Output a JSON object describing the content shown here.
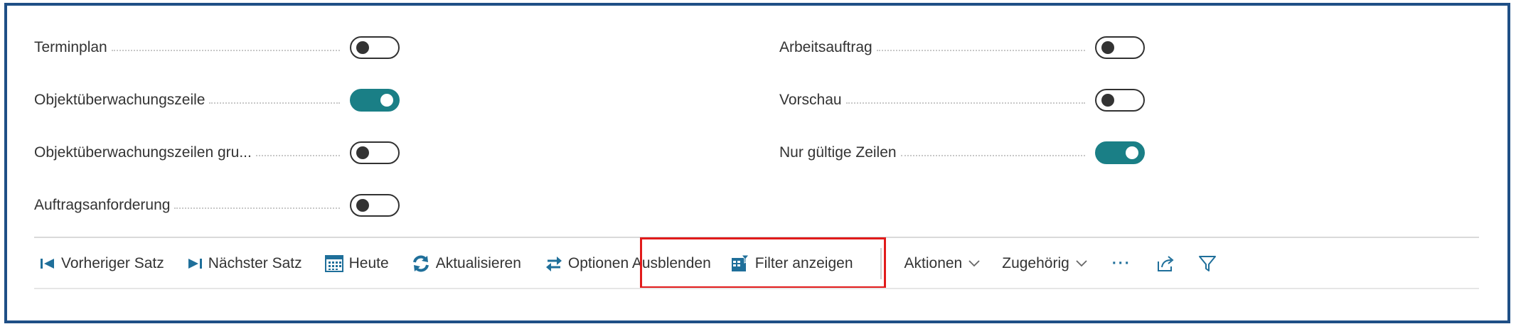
{
  "options": {
    "left": [
      {
        "label": "Terminplan",
        "on": false
      },
      {
        "label": "Objektüberwachungszeile",
        "on": true
      },
      {
        "label": "Objektüberwachungszeilen gru...",
        "on": false
      },
      {
        "label": "Auftragsanforderung",
        "on": false
      }
    ],
    "right": [
      {
        "label": "Arbeitsauftrag",
        "on": false
      },
      {
        "label": "Vorschau",
        "on": false
      },
      {
        "label": "Nur gültige Zeilen",
        "on": true
      }
    ]
  },
  "toolbar": {
    "prev_record": "Vorheriger Satz",
    "next_record": "Nächster Satz",
    "today": "Heute",
    "refresh": "Aktualisieren",
    "hide_options": "Optionen Ausblenden",
    "show_filter": "Filter anzeigen",
    "actions": "Aktionen",
    "related": "Zugehörig",
    "more": "···"
  },
  "colors": {
    "accent": "#1a7f86",
    "frame": "#1f4f86",
    "highlight": "#e11b1b",
    "icon_blue": "#1f6f9a"
  }
}
